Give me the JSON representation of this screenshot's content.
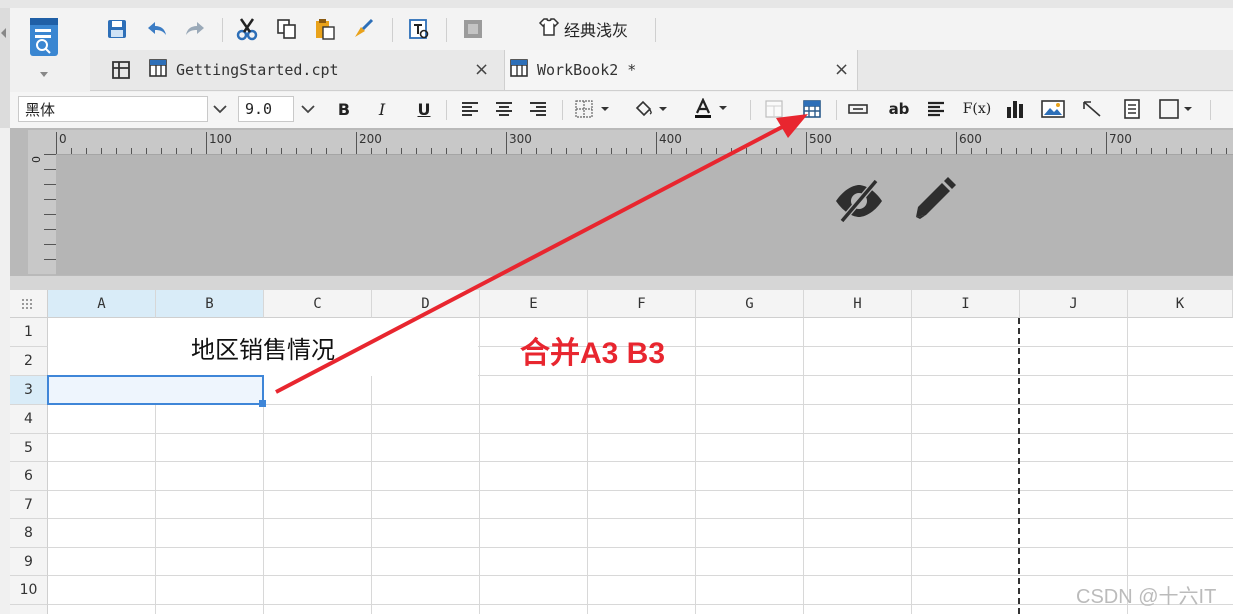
{
  "toolbar_top": {
    "theme_label": "经典浅灰"
  },
  "tabs": [
    {
      "label": "GettingStarted.cpt"
    },
    {
      "label": "WorkBook2 *"
    }
  ],
  "format_toolbar": {
    "font_name": "黑体",
    "font_size": "9.0",
    "bold_label": "B",
    "italic_label": "I",
    "underline_label": "U",
    "ab_label": "ab",
    "fx_label": "F(x)"
  },
  "ruler": {
    "labels": [
      "0",
      "100",
      "200",
      "300",
      "400",
      "500",
      "600",
      "700"
    ],
    "vertical_label": "0"
  },
  "grid": {
    "columns": [
      "A",
      "B",
      "C",
      "D",
      "E",
      "F",
      "G",
      "H",
      "I",
      "J",
      "K"
    ],
    "rows": [
      "1",
      "2",
      "3",
      "4",
      "5",
      "6",
      "7",
      "8",
      "9",
      "10"
    ],
    "merged_title": "地区销售情况",
    "selected_cell": "A3"
  },
  "annotation": "合并A3 B3",
  "watermark": "CSDN @十六IT",
  "colors": {
    "annotation": "#e8262f",
    "selection": "#3f86d8",
    "header_selected": "#d9ecf8"
  }
}
